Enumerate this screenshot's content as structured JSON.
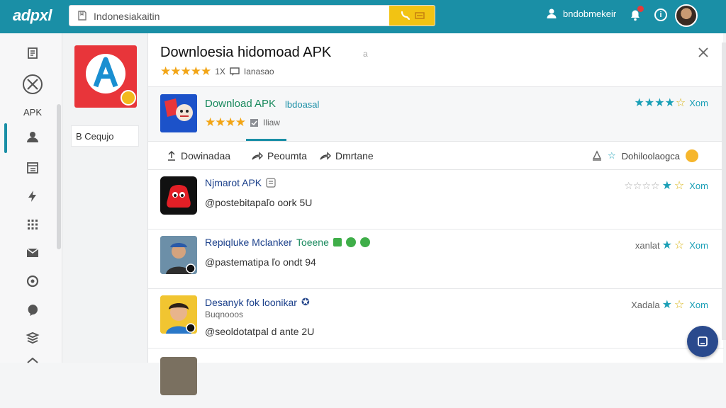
{
  "app": {
    "logo": "adpxl"
  },
  "search": {
    "value": "Indonesiakaitin"
  },
  "user": {
    "name": "bndobmekeir"
  },
  "rail": {
    "apk_label": "APK"
  },
  "sidebar": {
    "item_label": "B Cequjo"
  },
  "detail": {
    "title": "Downloesia hidomoad APK",
    "title_marker": "a",
    "rating_count": "1X",
    "review_text": "Ianasao"
  },
  "featured": {
    "title": "Download APK",
    "subtitle": "lbdoasal",
    "view_label": "Iliaw",
    "rank_label": "Xom"
  },
  "tabs": [
    {
      "label": "Dowinadaa"
    },
    {
      "label": "Peoumta"
    },
    {
      "label": "Dmrtane"
    }
  ],
  "tab_right": {
    "label": "Dohiloolaogca"
  },
  "list": [
    {
      "title": "Njmarot APK",
      "meta": "@postebitapaľo oork 5U",
      "rating_text": "",
      "rank": "Xom"
    },
    {
      "title": "Repiqluke Mclanker",
      "tag": "Toeene",
      "meta": "@pastematipa ľo ondt 94",
      "rating_text": "xanlat",
      "rank": "Xom"
    },
    {
      "title": "Desanyk fok loonikar",
      "sub": "Buqnooos",
      "meta": "@seoldotatpal d ante 2U",
      "rating_text": "Xadala",
      "rank": "Xom"
    }
  ],
  "colors": {
    "topbar": "#1a8fa6",
    "accent": "#1a9fb6",
    "star": "#f2a516",
    "search_button": "#f2c313"
  }
}
